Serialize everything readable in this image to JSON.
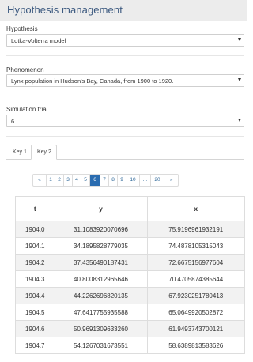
{
  "panel": {
    "title": "Hypothesis management"
  },
  "hypothesis": {
    "label": "Hypothesis",
    "value": "Lotka-Volterra model"
  },
  "phenomenon": {
    "label": "Phenomenon",
    "value": "Lynx population in Hudson's Bay, Canada, from 1900 to 1920."
  },
  "simulation": {
    "label": "Simulation trial",
    "value": "6"
  },
  "tabs": [
    {
      "label": "Key 1",
      "active": false
    },
    {
      "label": "Key 2",
      "active": true
    }
  ],
  "pagination": {
    "items": [
      "«",
      "1",
      "2",
      "3",
      "4",
      "5",
      "6",
      "7",
      "8",
      "9",
      "10",
      "...",
      "20",
      "»"
    ],
    "active": "6"
  },
  "table": {
    "headers": [
      "t",
      "y",
      "x"
    ],
    "rows": [
      [
        "1904.0",
        "31.1083920070696",
        "75.9196961932191"
      ],
      [
        "1904.1",
        "34.1895828779035",
        "74.4878105315043"
      ],
      [
        "1904.2",
        "37.4356490187431",
        "72.6675156977604"
      ],
      [
        "1904.3",
        "40.8008312965646",
        "70.4705874385644"
      ],
      [
        "1904.4",
        "44.2262696820135",
        "67.9230251780413"
      ],
      [
        "1904.5",
        "47.6417755935588",
        "65.0649920502872"
      ],
      [
        "1904.6",
        "50.9691309633260",
        "61.9493743700121"
      ],
      [
        "1904.7",
        "54.1267031673551",
        "58.6389813583626"
      ]
    ]
  }
}
